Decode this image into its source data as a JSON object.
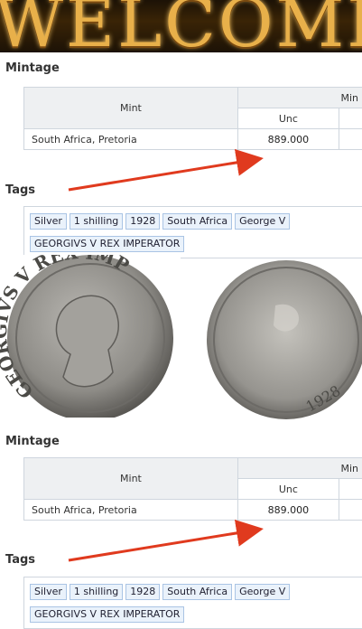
{
  "banner": {
    "text": "WELCOME"
  },
  "sections": [
    {
      "mintage_heading": "Mintage",
      "table": {
        "mint_header": "Mint",
        "group_header": "Min",
        "sub_header": "Unc",
        "row_mint": "South Africa, Pretoria",
        "row_value": "889.000"
      },
      "tags_heading": "Tags",
      "tags": [
        "Silver",
        "1 shilling",
        "1928",
        "South Africa",
        "George V",
        "GEORGIVS V REX IMPERATOR"
      ]
    },
    {
      "mintage_heading": "Mintage",
      "table": {
        "mint_header": "Mint",
        "group_header": "Min",
        "sub_header": "Unc",
        "row_mint": "South Africa, Pretoria",
        "row_value": "889.000"
      },
      "tags_heading": "Tags",
      "tags": [
        "Silver",
        "1 shilling",
        "1928",
        "South Africa",
        "George V",
        "GEORGIVS V REX IMPERATOR"
      ]
    }
  ],
  "coin": {
    "obverse_legend": "GEORGIVS V REX IMPERATOR",
    "reverse_legend": "1928"
  },
  "colors": {
    "arrow": "#e03a1e",
    "tag_bg": "#eaf2fb",
    "tag_border": "#aac4e4"
  }
}
